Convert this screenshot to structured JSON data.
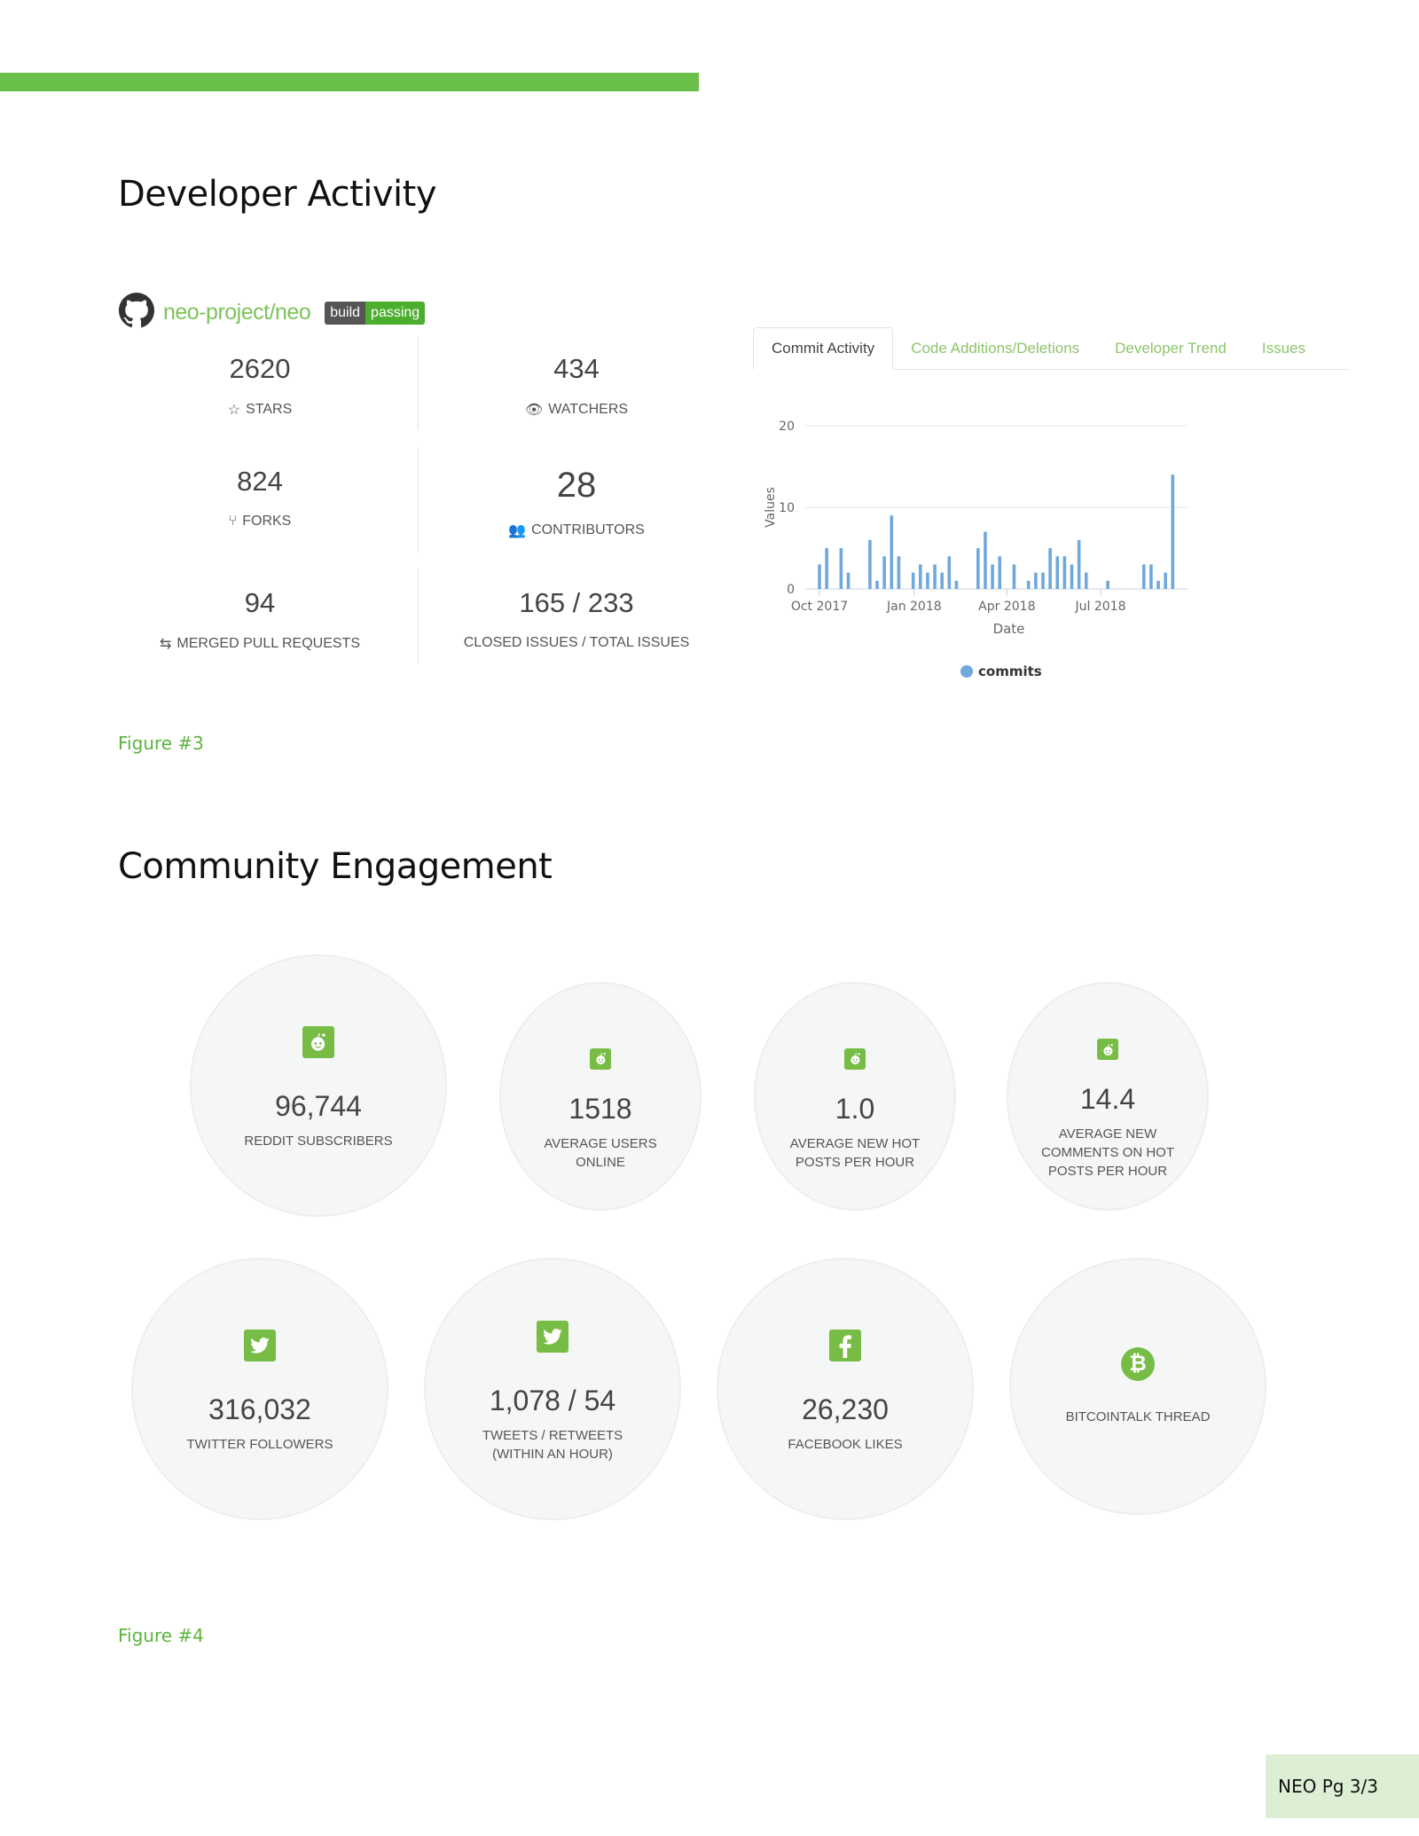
{
  "developer_activity": {
    "title": "Developer Activity",
    "repo": {
      "name": "neo-project/neo",
      "badge_left": "build",
      "badge_right": "passing"
    },
    "stats": [
      {
        "value": "2620",
        "label": "STARS",
        "icon": "star-icon"
      },
      {
        "value": "434",
        "label": "WATCHERS",
        "icon": "eye-icon"
      },
      {
        "value": "824",
        "label": "FORKS",
        "icon": "fork-icon"
      },
      {
        "value": "28",
        "label": "CONTRIBUTORS",
        "icon": "users-icon"
      },
      {
        "value": "94",
        "label": "MERGED PULL REQUESTS",
        "icon": "merge-icon"
      },
      {
        "value": "165 / 233",
        "label": "CLOSED ISSUES / TOTAL ISSUES"
      }
    ],
    "tabs": [
      "Commit Activity",
      "Code Additions/Deletions",
      "Developer Trend",
      "Issues"
    ],
    "active_tab": "Commit Activity",
    "figure_caption": "Figure #3"
  },
  "chart_data": {
    "type": "bar",
    "xlabel": "Date",
    "ylabel": "Values",
    "ylim": [
      0,
      20
    ],
    "yticks": [
      "0",
      "10",
      "20"
    ],
    "xticks": [
      {
        "date": "2017-10-01",
        "label": "Oct 2017"
      },
      {
        "date": "2018-01-01",
        "label": "Jan 2018"
      },
      {
        "date": "2018-04-01",
        "label": "Apr 2018"
      },
      {
        "date": "2018-07-01",
        "label": "Jul 2018"
      }
    ],
    "grid": true,
    "legend_position": "bottom",
    "series": [
      {
        "name": "commits",
        "color": "#6fa8dc",
        "points": [
          [
            "2017-10-01",
            3
          ],
          [
            "2017-10-08",
            5
          ],
          [
            "2017-10-22",
            5
          ],
          [
            "2017-10-29",
            2
          ],
          [
            "2017-11-19",
            6
          ],
          [
            "2017-11-26",
            1
          ],
          [
            "2017-12-03",
            4
          ],
          [
            "2017-12-10",
            9
          ],
          [
            "2017-12-17",
            4
          ],
          [
            "2017-12-31",
            2
          ],
          [
            "2018-01-07",
            3
          ],
          [
            "2018-01-14",
            2
          ],
          [
            "2018-01-21",
            3
          ],
          [
            "2018-01-28",
            2
          ],
          [
            "2018-02-04",
            4
          ],
          [
            "2018-02-11",
            1
          ],
          [
            "2018-03-04",
            5
          ],
          [
            "2018-03-11",
            7
          ],
          [
            "2018-03-18",
            3
          ],
          [
            "2018-03-25",
            4
          ],
          [
            "2018-04-08",
            3
          ],
          [
            "2018-04-22",
            1
          ],
          [
            "2018-04-29",
            2
          ],
          [
            "2018-05-06",
            2
          ],
          [
            "2018-05-13",
            5
          ],
          [
            "2018-05-20",
            4
          ],
          [
            "2018-05-27",
            4
          ],
          [
            "2018-06-03",
            3
          ],
          [
            "2018-06-10",
            6
          ],
          [
            "2018-06-17",
            2
          ],
          [
            "2018-07-08",
            1
          ],
          [
            "2018-08-12",
            3
          ],
          [
            "2018-08-19",
            3
          ],
          [
            "2018-08-26",
            1
          ],
          [
            "2018-09-02",
            2
          ],
          [
            "2018-09-09",
            14
          ]
        ]
      }
    ]
  },
  "community": {
    "title": "Community Engagement",
    "row1": [
      {
        "value": "96,744",
        "label": "REDDIT SUBSCRIBERS",
        "icon": "reddit-icon"
      },
      {
        "value": "1518",
        "label": "AVERAGE USERS\nONLINE",
        "icon": "reddit-icon"
      },
      {
        "value": "1.0",
        "label": "AVERAGE NEW HOT\nPOSTS PER HOUR",
        "icon": "reddit-icon"
      },
      {
        "value": "14.4",
        "label": "AVERAGE NEW\nCOMMENTS ON HOT\nPOSTS PER HOUR",
        "icon": "reddit-icon"
      }
    ],
    "row2": [
      {
        "value": "316,032",
        "label": "TWITTER FOLLOWERS",
        "icon": "twitter-icon"
      },
      {
        "value": "1,078 / 54",
        "label": "TWEETS / RETWEETS\n(WITHIN AN HOUR)",
        "icon": "twitter-icon"
      },
      {
        "value": "26,230",
        "label": "FACEBOOK LIKES",
        "icon": "facebook-icon"
      },
      {
        "label": "BITCOINTALK THREAD",
        "icon": "bitcoin-icon"
      }
    ],
    "figure_caption": "Figure #4"
  },
  "footer": {
    "page": "NEO Pg 3/3"
  },
  "colors": {
    "accent": "#6abf4b",
    "footer_bg": "#dcefd5",
    "bar": "#6fa8dc"
  }
}
